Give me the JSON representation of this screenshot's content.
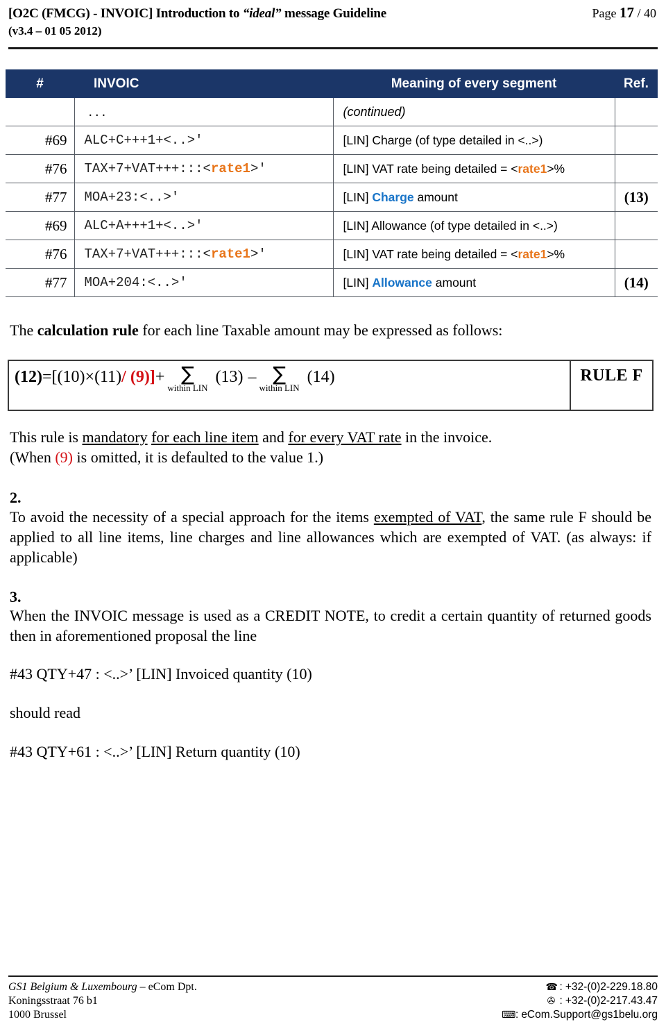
{
  "header": {
    "title_main": "[O2C (FMCG) - INVOIC]  Introduction to ",
    "title_quoted": "“ideal”",
    "title_tail": " message Guideline",
    "page_label": "Page ",
    "page_number": "17",
    "page_total": " / 40",
    "version_line": "(v3.4 – 01 05 2012)"
  },
  "table": {
    "columns": [
      "#",
      "INVOIC",
      "Meaning of every segment",
      "Ref."
    ],
    "rows": [
      {
        "num": "",
        "invoic": "...",
        "meaning_prefix": "(continued)",
        "ref": "",
        "kind": "continued"
      },
      {
        "num": "#69",
        "invoic": "ALC+C+++1+<..>'",
        "meaning": "[LIN] Charge (of type detailed in <..>)",
        "ref": ""
      },
      {
        "num": "#76",
        "invoic_pre": "TAX+7+VAT+++:::<",
        "invoic_token": "rate1",
        "invoic_post": ">'",
        "meaning_pre": "[LIN] VAT rate being detailed = <",
        "meaning_token": "rate1",
        "meaning_post": ">%",
        "ref": ""
      },
      {
        "num": "#77",
        "invoic": "MOA+23:<..>'",
        "meaning_pre": "[LIN] ",
        "meaning_accent": "Charge",
        "meaning_post": " amount",
        "ref": "(13)"
      },
      {
        "num": "#69",
        "invoic": "ALC+A+++1+<..>'",
        "meaning": "[LIN] Allowance (of type detailed in <..>)",
        "ref": ""
      },
      {
        "num": "#76",
        "invoic_pre": "TAX+7+VAT+++:::<",
        "invoic_token": "rate1",
        "invoic_post": ">'",
        "meaning_pre": "[LIN] VAT rate being detailed = <",
        "meaning_token": "rate1",
        "meaning_post": ">%",
        "ref": ""
      },
      {
        "num": "#77",
        "invoic": "MOA+204:<..>'",
        "meaning_pre": "[LIN] ",
        "meaning_accent": "Allowance",
        "meaning_post": " amount",
        "ref": "(14)"
      }
    ]
  },
  "calc": {
    "intro_pre": "The ",
    "intro_bold": "calculation rule",
    "intro_post": " for each line Taxable amount may be expressed as follows:",
    "formula": {
      "result": "(12)",
      "equals": " = ",
      "bracket_open": "[(10) ",
      "times": "×",
      "operand2": " (11) ",
      "red_part": "/ (9)]",
      "plus": " + ",
      "sigma": "∑",
      "sigma_sub": "within LIN",
      "term1": "(13)",
      "minus": "–",
      "term2": "(14)"
    },
    "rule_label": "RULE F"
  },
  "notes": {
    "rule_mandatory_1": "This rule is ",
    "rule_mandatory_u1": "mandatory",
    "rule_mandatory_2": " ",
    "rule_mandatory_u2": "for each line item",
    "rule_mandatory_3": " and ",
    "rule_mandatory_u3": "for every VAT rate",
    "rule_mandatory_4": " in the invoice.",
    "default_pre": "(When ",
    "default_red": "(9)",
    "default_post": " is omitted, it is defaulted to the value 1.)",
    "item2_number": "2.",
    "item2_pre": "To avoid the necessity of a special approach for the items ",
    "item2_u": "exempted of VAT",
    "item2_post": ", the same rule F should be applied to all line items, line charges and line allowances which are exempted of VAT. (as always: if applicable)",
    "item3_number": "3.",
    "item3_text": "When the INVOIC message is used as a CREDIT NOTE, to credit a certain quantity of returned goods then in aforementioned proposal the line",
    "line_old": "#43 QTY+47 : <..>’ [LIN] Invoiced quantity (10)",
    "should_read": "should read",
    "line_new": "#43 QTY+61 : <..>’ [LIN] Return quantity (10)"
  },
  "footer": {
    "org": "GS1 Belgium & Luxembourg",
    "org_tail": " – eCom Dpt.",
    "address1": "Koningsstraat 76 b1",
    "address2": "1000 Brussel",
    "phone_icon": "☎",
    "phone_sep": " : ",
    "phone": "+32-(0)2-229.18.80",
    "fax_icon": "✇",
    "fax_sep": " : ",
    "fax": "+32-(0)2-217.43.47",
    "mail_icon": "⌨",
    "mail_sep": " : ",
    "email": "eCom.Support@gs1belu.org"
  },
  "colors": {
    "header_bg": "#1b3668",
    "accent_orange": "#e8751a",
    "accent_blue": "#1874c8",
    "accent_red": "#d41116"
  }
}
